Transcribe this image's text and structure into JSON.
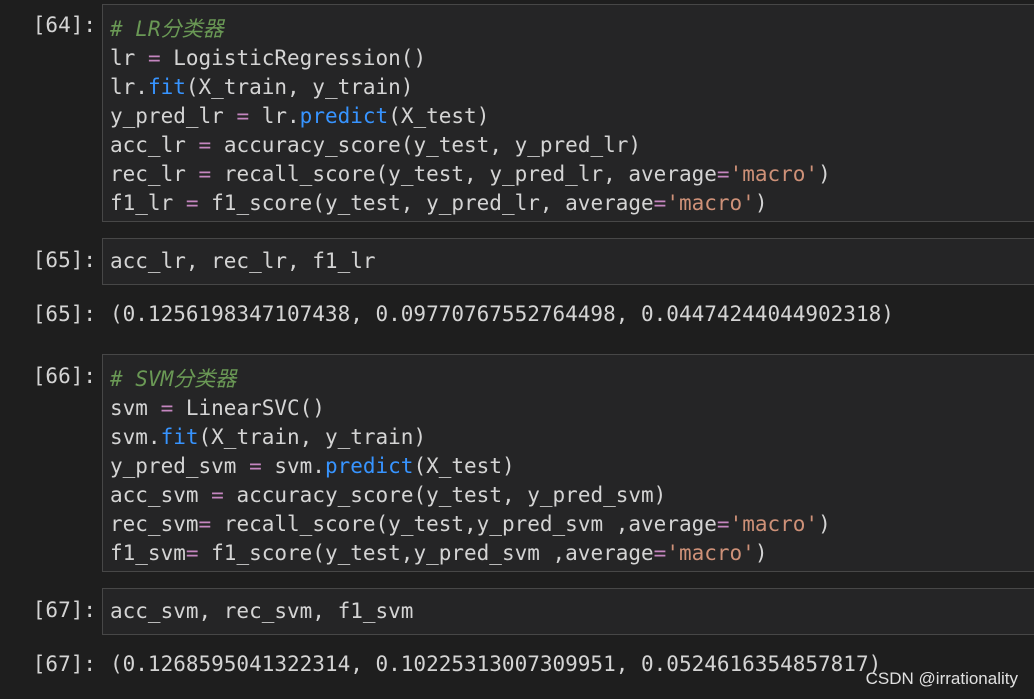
{
  "theme": {
    "background": "#1e1e1e",
    "cell_background": "#252526",
    "cell_border": "#474747",
    "comment_color": "#6a9955",
    "builtin_color": "#3794ff",
    "operator_color": "#c586c0",
    "string_color": "#ce9178"
  },
  "cells": {
    "c64": {
      "prompt": "[64]:",
      "line1": "# LR分类器",
      "line2": {
        "a": "lr ",
        "op": "=",
        "b": " LogisticRegression()"
      },
      "line3": {
        "a": "lr.",
        "fn": "fit",
        "b": "(X_train, y_train)"
      },
      "line4": {
        "a": "y_pred_lr ",
        "op": "=",
        "b": " lr.",
        "fn": "predict",
        "c": "(X_test)"
      },
      "line5": {
        "a": "acc_lr ",
        "op": "=",
        "b": " accuracy_score(y_test, y_pred_lr)"
      },
      "line6": {
        "a": "rec_lr ",
        "op": "=",
        "b": " recall_score(y_test, y_pred_lr, average",
        "op2": "=",
        "str": "'macro'",
        "c": ")"
      },
      "line7": {
        "a": "f1_lr ",
        "op": "=",
        "b": " f1_score(y_test, y_pred_lr, average",
        "op2": "=",
        "str": "'macro'",
        "c": ")"
      }
    },
    "c65": {
      "prompt": "[65]:",
      "line1": "acc_lr, rec_lr, f1_lr",
      "out_prompt": "[65]:",
      "output": "(0.1256198347107438, 0.09770767552764498, 0.04474244044902318)"
    },
    "c66": {
      "prompt": "[66]:",
      "line1": "# SVM分类器",
      "line2": {
        "a": "svm ",
        "op": "=",
        "b": " LinearSVC()"
      },
      "line3": {
        "a": "svm.",
        "fn": "fit",
        "b": "(X_train, y_train)"
      },
      "line4": {
        "a": "y_pred_svm ",
        "op": "=",
        "b": " svm.",
        "fn": "predict",
        "c": "(X_test)"
      },
      "line5": {
        "a": "acc_svm ",
        "op": "=",
        "b": " accuracy_score(y_test, y_pred_svm)"
      },
      "line6": {
        "a": "rec_svm",
        "op": "=",
        "b": " recall_score(y_test,y_pred_svm ,average",
        "op2": "=",
        "str": "'macro'",
        "c": ")"
      },
      "line7": {
        "a": "f1_svm",
        "op": "=",
        "b": " f1_score(y_test,y_pred_svm ,average",
        "op2": "=",
        "str": "'macro'",
        "c": ")"
      }
    },
    "c67": {
      "prompt": "[67]:",
      "line1": "acc_svm, rec_svm, f1_svm",
      "out_prompt": "[67]:",
      "output": "(0.1268595041322314, 0.10225313007309951, 0.0524616354857817)"
    }
  },
  "watermark": "CSDN @irrationality"
}
